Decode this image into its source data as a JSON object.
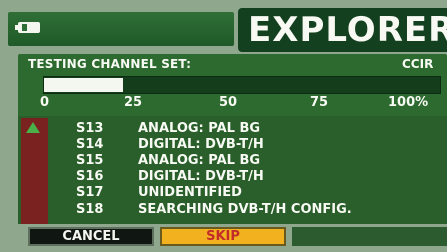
{
  "header": {
    "title": "EXPLORER",
    "battery_icon": "battery-icon"
  },
  "scan": {
    "label": "TESTING CHANNEL SET:",
    "channel_set": "CCIR",
    "progress_fraction": 0.2
  },
  "scale": {
    "ticks": [
      "0",
      "25",
      "50",
      "75",
      "100%"
    ]
  },
  "channels": [
    {
      "id": "S13",
      "status": "ANALOG: PAL BG"
    },
    {
      "id": "S14",
      "status": "DIGITAL: DVB-T/H"
    },
    {
      "id": "S15",
      "status": "ANALOG: PAL BG"
    },
    {
      "id": "S16",
      "status": "DIGITAL: DVB-T/H"
    },
    {
      "id": "S17",
      "status": "UNIDENTIFIED"
    },
    {
      "id": "S18",
      "status": "SEARCHING DVB-T/H CONFIG."
    }
  ],
  "buttons": {
    "cancel": "CANCEL",
    "skip": "SKIP"
  },
  "colors": {
    "panel": "#2c6a2f",
    "title_bg": "#13401e",
    "skip_bg": "#f2b11e",
    "skip_text": "#c32b2a",
    "scroll": "#7a221f"
  }
}
